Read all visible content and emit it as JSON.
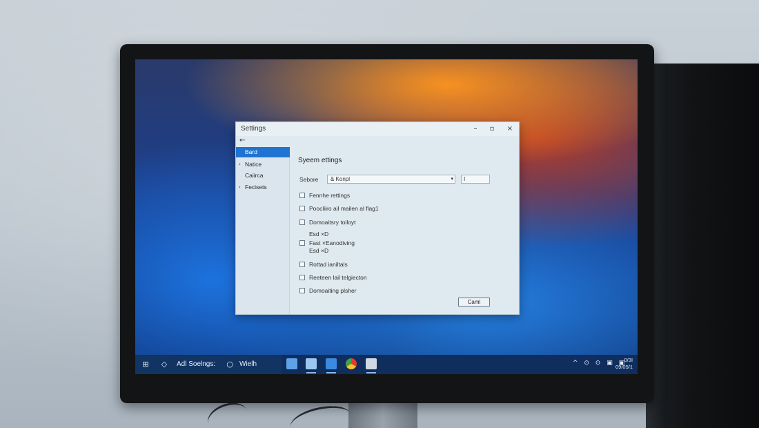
{
  "window": {
    "title": "Settings",
    "minimize_icon": "minimize-icon",
    "maximize_icon": "maximize-icon",
    "close_icon": "close-icon",
    "back_icon": "back-arrow-icon"
  },
  "sidebar": {
    "items": [
      {
        "label": "Bard",
        "active": true
      },
      {
        "label": "Natice",
        "active": false
      },
      {
        "label": "Caiirca",
        "active": false
      },
      {
        "label": "Fecisets",
        "active": false
      }
    ]
  },
  "main": {
    "heading": "Syeem ettings",
    "search_label": "Sebore",
    "search_value": "& Konpl",
    "small_field_value": "I",
    "checkboxes": [
      {
        "label": "Fennhe rettings"
      },
      {
        "label": "Poocliiro ail mailen al flag1"
      },
      {
        "label": "Domoaitsry toiloyt"
      },
      {
        "label": "Fast ×Eanodiving",
        "above": "Esd ×D",
        "below": "Esd ×D"
      },
      {
        "label": "Rottad ianiltals"
      },
      {
        "label": "Reeteen lail telgiecton"
      },
      {
        "label": "Domoaiting plsher"
      }
    ],
    "cancel_label": "Caml"
  },
  "taskbar": {
    "start_icon": "windows-start-icon",
    "search_text": "Adl Soelngs:",
    "widget_text": "Wielh",
    "tray_icons": "^ ⊙ ⊙ ▣ ▣",
    "time": "0/3I",
    "date": "09/05/1"
  },
  "colors": {
    "accent": "#1f74d2",
    "taskbar": "#0f2e5e"
  }
}
